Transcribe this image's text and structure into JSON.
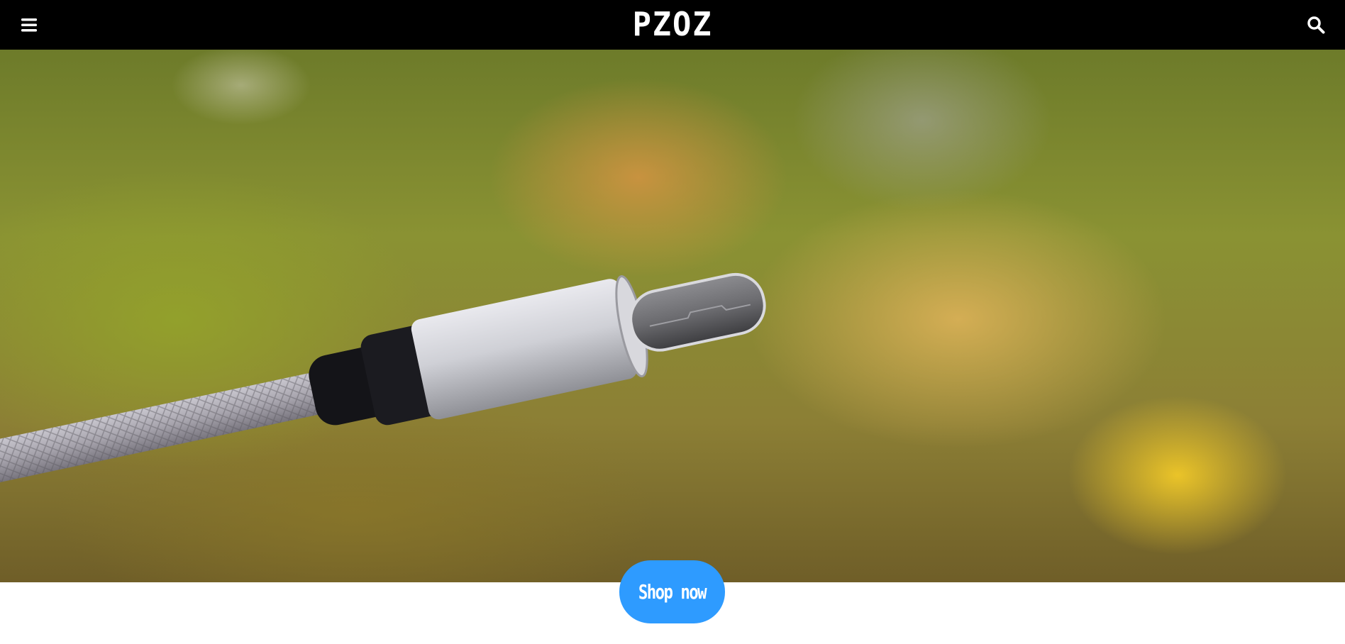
{
  "header": {
    "logo_text": "PZOZ",
    "menu_icon": "hamburger-menu-icon",
    "search_icon": "search-icon",
    "background": "#000000"
  },
  "hero": {
    "image_subject": "usb-c-cable-connector"
  },
  "cta": {
    "label": "Shop now",
    "color": "#2e9bff"
  }
}
